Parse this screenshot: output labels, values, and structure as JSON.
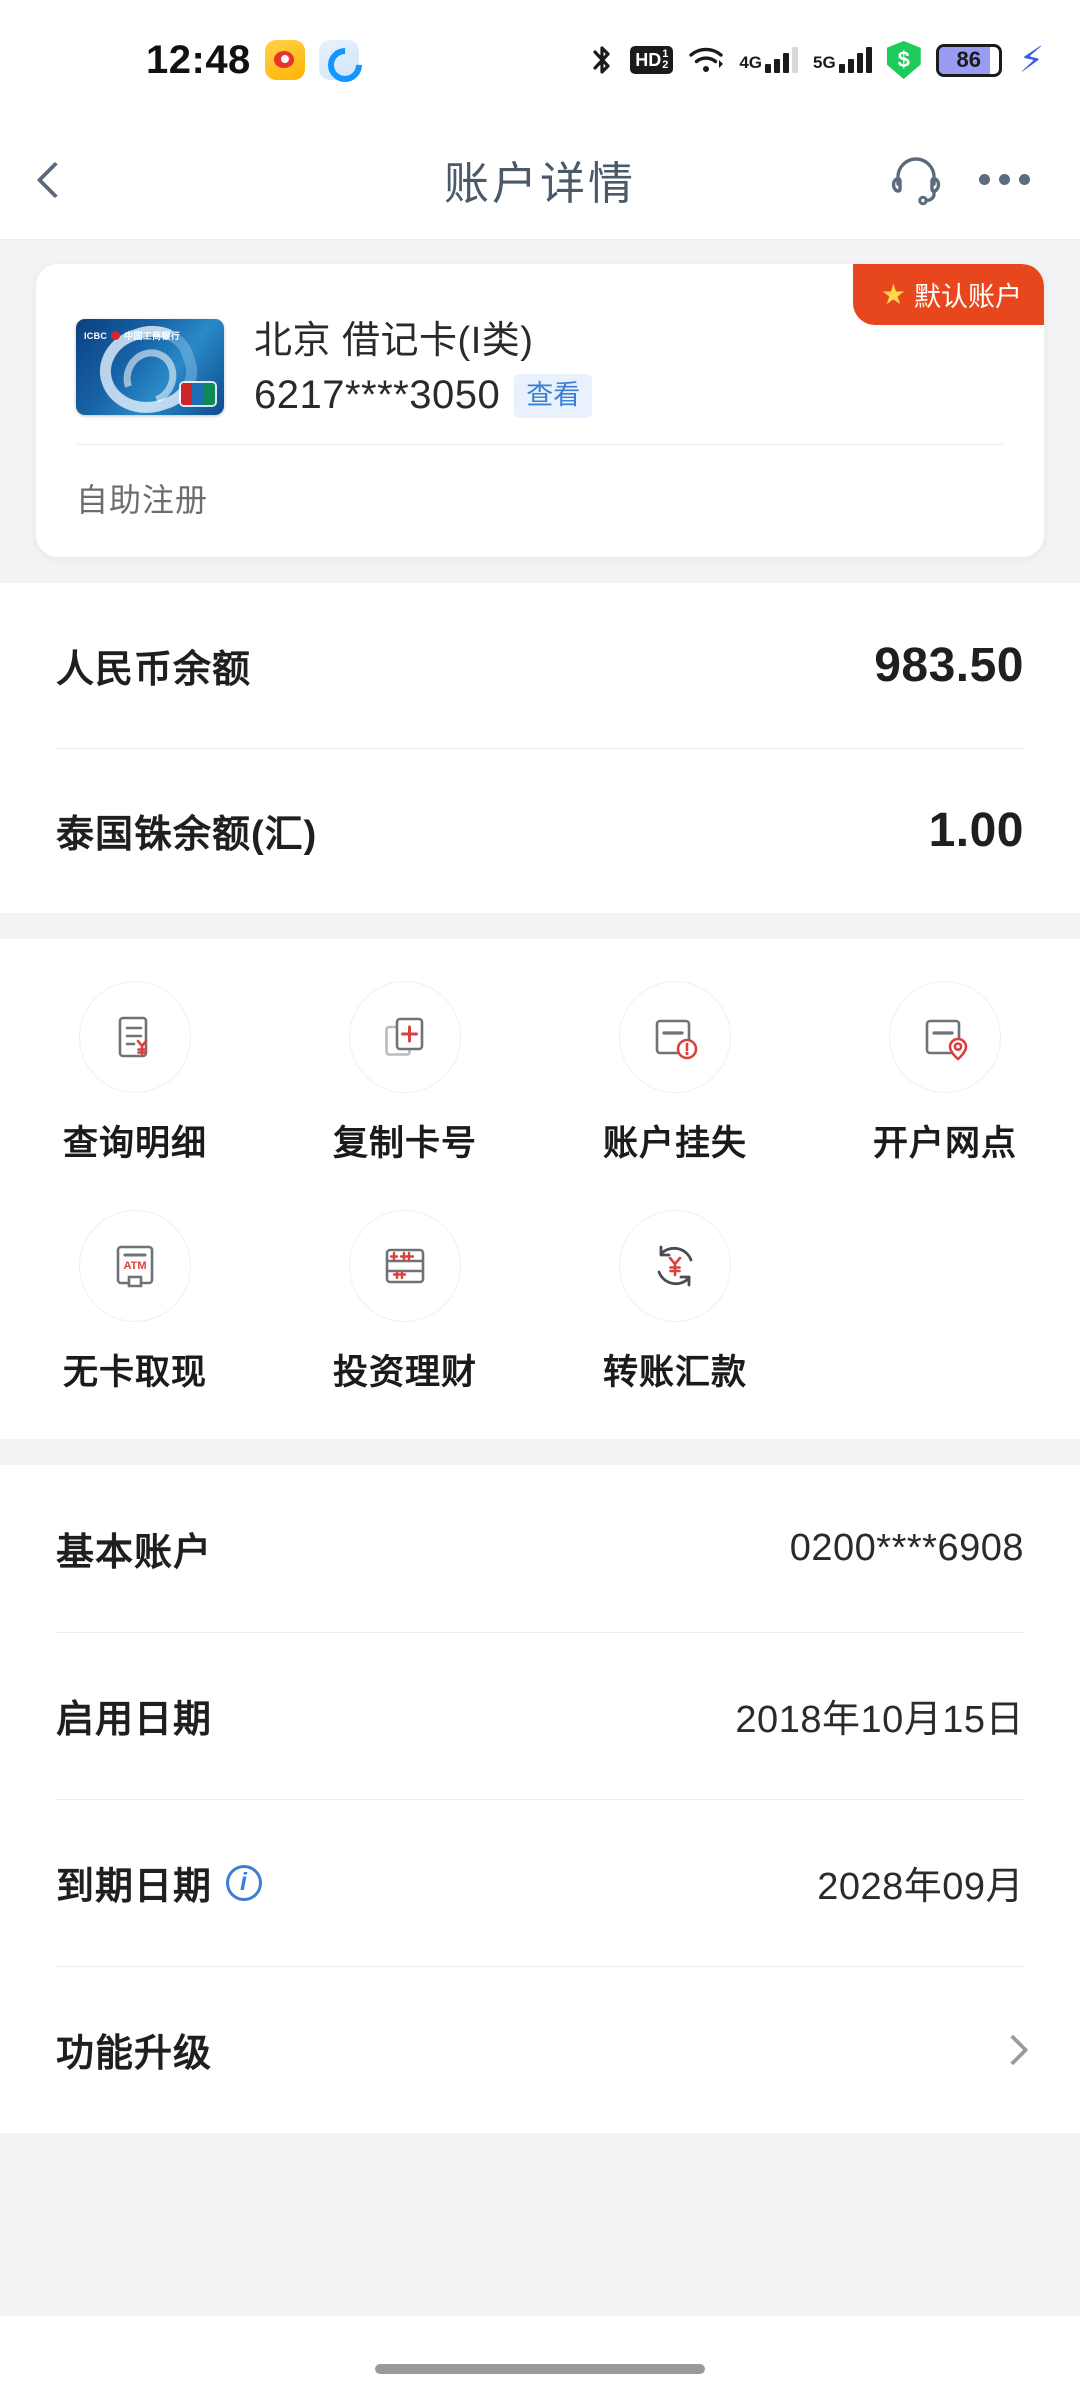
{
  "status_bar": {
    "time": "12:48",
    "app_icons": [
      "weibo-icon",
      "qq-browser-icon"
    ],
    "right_icons": [
      "bluetooth-icon",
      "hd-volte-icon",
      "wifi-icon",
      "4g-signal-icon",
      "5g-signal-icon",
      "security-shield-icon",
      "battery-icon",
      "charging-bolt-icon"
    ],
    "volte_label": "HD",
    "volte_sub_top": "1",
    "volte_sub_bottom": "2",
    "net_4g_label": "4G",
    "net_5g_label": "5G",
    "shield_symbol": "$",
    "battery_level": "86"
  },
  "header": {
    "title": "账户详情",
    "back_icon": "chevron-left-icon",
    "support_icon": "headset-icon",
    "more_icon": "more-dots-icon"
  },
  "card": {
    "badge_label": "默认账户",
    "badge_star": "★",
    "bank_mark": "ICBC",
    "bank_name": "中国工商银行",
    "card_title": "北京 借记卡(I类)",
    "card_number": "6217****3050",
    "view_label": "查看",
    "registration": "自助注册"
  },
  "balances": [
    {
      "label": "人民币余额",
      "value": "983.50"
    },
    {
      "label": "泰国铢余额(汇)",
      "value": "1.00"
    }
  ],
  "actions": [
    [
      {
        "label": "查询明细",
        "icon": "statement-yen-icon"
      },
      {
        "label": "复制卡号",
        "icon": "copy-plus-icon"
      },
      {
        "label": "账户挂失",
        "icon": "card-alert-icon"
      },
      {
        "label": "开户网点",
        "icon": "card-location-icon"
      }
    ],
    [
      {
        "label": "无卡取现",
        "icon": "atm-icon",
        "atm_text": "ATM"
      },
      {
        "label": "投资理财",
        "icon": "abacus-icon"
      },
      {
        "label": "转账汇款",
        "icon": "transfer-yen-icon"
      }
    ]
  ],
  "details": [
    {
      "label": "基本账户",
      "value": "0200****6908",
      "has_info": false,
      "has_chevron": false
    },
    {
      "label": "启用日期",
      "value": "2018年10月15日",
      "has_info": false,
      "has_chevron": false
    },
    {
      "label": "到期日期",
      "value": "2028年09月",
      "has_info": true,
      "info_icon": "info-circle-icon",
      "has_chevron": false
    },
    {
      "label": "功能升级",
      "value": "",
      "has_info": false,
      "has_chevron": true,
      "chevron_icon": "chevron-right-icon"
    }
  ],
  "colors": {
    "accent_red": "#e8471e",
    "link_blue": "#3b7fd4",
    "page_bg": "#f2f3f5",
    "icon_red": "#d9413c",
    "icon_gray": "#6f7276"
  }
}
